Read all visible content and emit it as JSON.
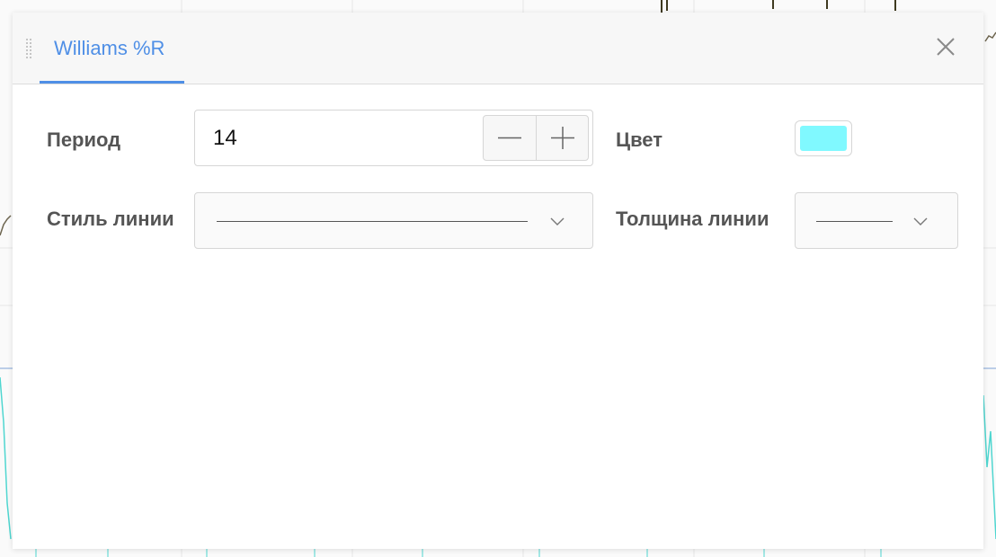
{
  "dialog": {
    "title": "Williams %R",
    "close_icon": "close-icon",
    "drag_icon": "drag-handle-icon"
  },
  "fields": {
    "period_label": "Период",
    "period_value": "14",
    "color_label": "Цвет",
    "color_value": "#80f9ff",
    "line_style_label": "Стиль линии",
    "line_style_value": "solid",
    "line_width_label": "Толщина линии",
    "line_width_value": "thin"
  },
  "colors": {
    "accent": "#4f8fe6",
    "swatch": "#80f9ff",
    "background_series": "#4fd6d0"
  }
}
